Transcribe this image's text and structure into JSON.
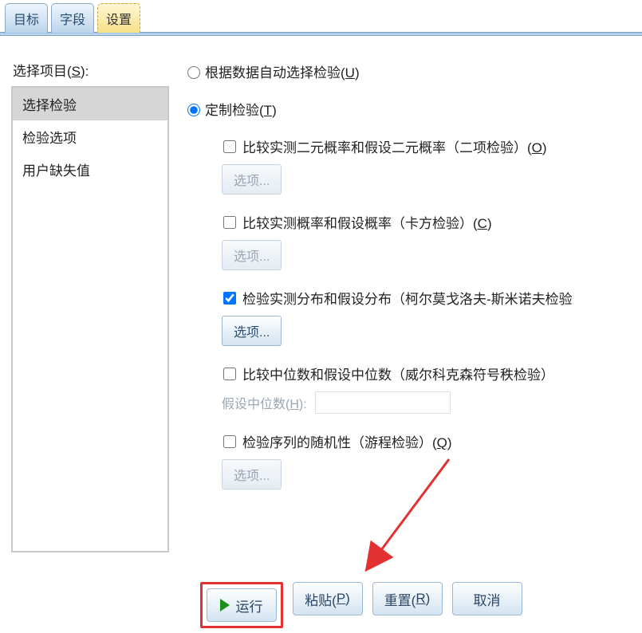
{
  "tabs": {
    "target": "目标",
    "fields": "字段",
    "settings": "设置"
  },
  "side": {
    "title_prefix": "选择项目(",
    "title_accel": "S",
    "title_suffix": "):",
    "items": [
      "选择检验",
      "检验选项",
      "用户缺失值"
    ]
  },
  "radios": {
    "auto_prefix": "根据数据自动选择检验(",
    "auto_accel": "U",
    "auto_suffix": ")",
    "custom_prefix": "定制检验(",
    "custom_accel": "T",
    "custom_suffix": ")"
  },
  "checks": {
    "binom": {
      "label_prefix": "比较实测二元概率和假设二元概率（二项检验）(",
      "accel": "O",
      "label_suffix": ")",
      "options": "选项..."
    },
    "chisq": {
      "label_prefix": "比较实测概率和假设概率（卡方检验）(",
      "accel": "C",
      "label_suffix": ")",
      "options": "选项..."
    },
    "ks": {
      "label": "检验实测分布和假设分布（柯尔莫戈洛夫-斯米诺夫检验",
      "options": "选项..."
    },
    "wilcox": {
      "label": "比较中位数和假设中位数（威尔科克森符号秩检验）",
      "hyp_prefix": "假设中位数(",
      "hyp_accel": "H",
      "hyp_suffix": "):",
      "hyp_value": ""
    },
    "runs": {
      "label_prefix": "检验序列的随机性（游程检验）(",
      "accel": "Q",
      "label_suffix": ")",
      "options": "选项..."
    }
  },
  "buttons": {
    "run": "运行",
    "paste_prefix": "粘贴(",
    "paste_accel": "P",
    "paste_suffix": ")",
    "reset_prefix": "重置(",
    "reset_accel": "R",
    "reset_suffix": ")",
    "cancel": "取消"
  }
}
